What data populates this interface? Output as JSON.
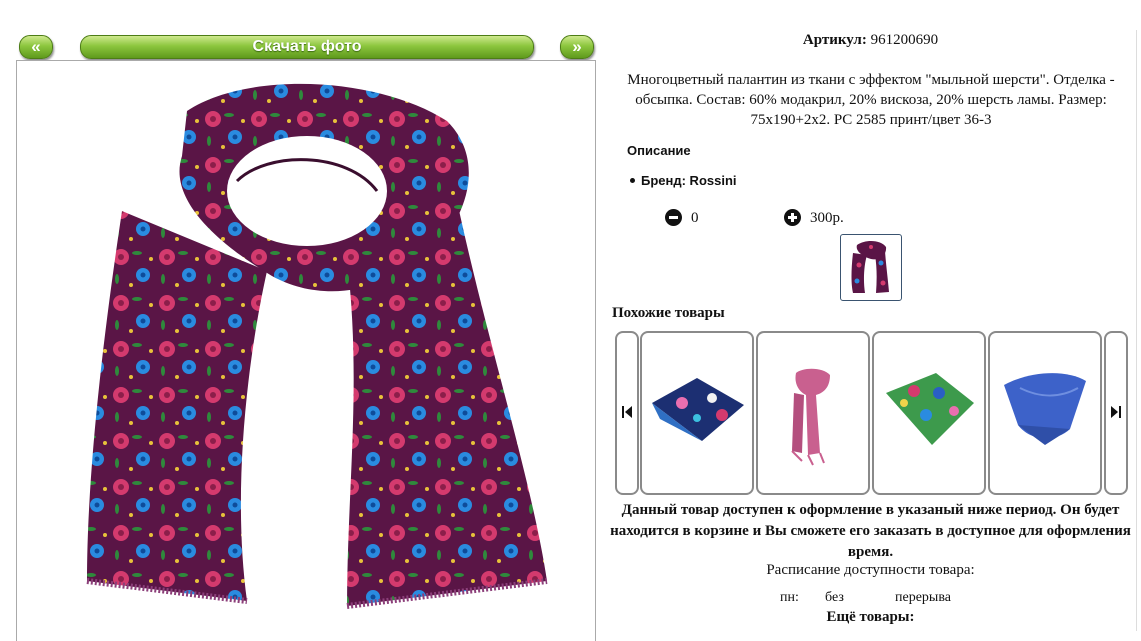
{
  "gallery": {
    "prev_label": "«",
    "download_label": "Скачать фото",
    "next_label": "»",
    "main_image": "scarf-photo"
  },
  "product": {
    "article_label": "Артикул:",
    "article_value": "961200690",
    "description": "Многоцветный палантин из ткани с эффектом \"мыльной шерсти\". Отделка - обсыпка. Состав: 60% модакрил, 20% вискоза, 20% шерсть ламы. Размер: 75x190+2x2. PC 2585 принт/цвет 36-3",
    "details_title": "Описание",
    "brand": "Бренд: Rossini",
    "quantity": "0",
    "price": "300р.",
    "minus_icon": "minus-circle-icon",
    "plus_icon": "plus-circle-icon"
  },
  "similar": {
    "title": "Похожие товары",
    "items": [
      {
        "name": "printed-square-scarf-blue",
        "color": "#2f6fc4"
      },
      {
        "name": "pink-long-scarf",
        "color": "#c9608f"
      },
      {
        "name": "floral-green-scarf",
        "color": "#3d9a4c"
      },
      {
        "name": "blue-square-scarf",
        "color": "#3d62c9"
      }
    ],
    "left_icon": "skip-back-icon",
    "right_icon": "skip-forward-icon"
  },
  "availability": {
    "notice": "Данный товар доступен к оформление в указаный ниже период. Он будет находится в корзине и Вы сможете его заказать в доступное для оформления время.",
    "schedule_title": "Расписание доступности товара:",
    "day": "пн:",
    "from": "без",
    "to": "перерыва"
  },
  "more_title": "Ещё товары:",
  "colors": {
    "button_green": "#8cc63e",
    "scarf_base": "#5a1546",
    "scarf_rose": "#d43a6e",
    "scarf_blue": "#2a8be0",
    "scarf_green": "#2f8a3c"
  }
}
